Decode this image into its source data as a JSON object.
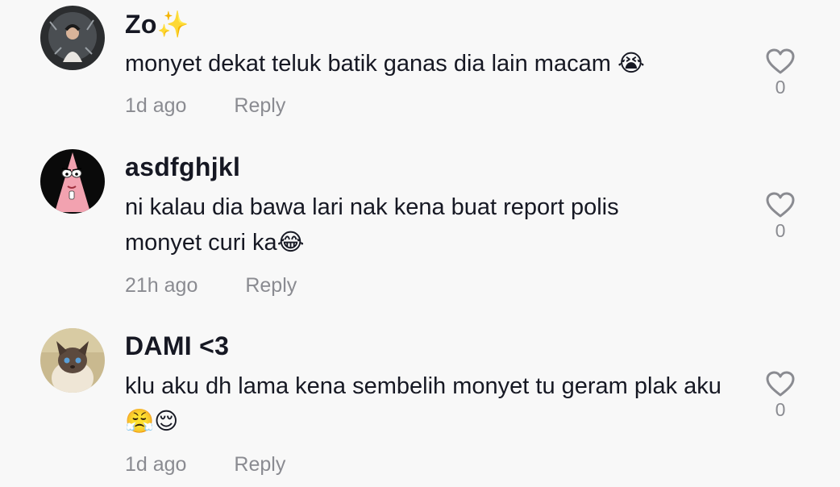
{
  "comments": [
    {
      "username": "Zo✨",
      "text": "monyet dekat teluk batik ganas dia lain macam 😭",
      "time": "1d ago",
      "reply_label": "Reply",
      "likes": "0",
      "avatar": "avatar-photo-person"
    },
    {
      "username": "asdfghjkl",
      "text": "ni kalau dia bawa lari nak kena buat report polis monyet curi ka😂",
      "time": "21h ago",
      "reply_label": "Reply",
      "likes": "0",
      "avatar": "avatar-pink-cartoon-starfish"
    },
    {
      "username": "DAMI <3",
      "text": "klu aku dh lama kena sembelih monyet tu geram plak aku 😤😌",
      "time": "1d ago",
      "reply_label": "Reply",
      "likes": "0",
      "avatar": "avatar-siamese-cat"
    }
  ],
  "colors": {
    "background": "#f8f8f8",
    "text": "#161823",
    "muted": "#8a8b91"
  }
}
